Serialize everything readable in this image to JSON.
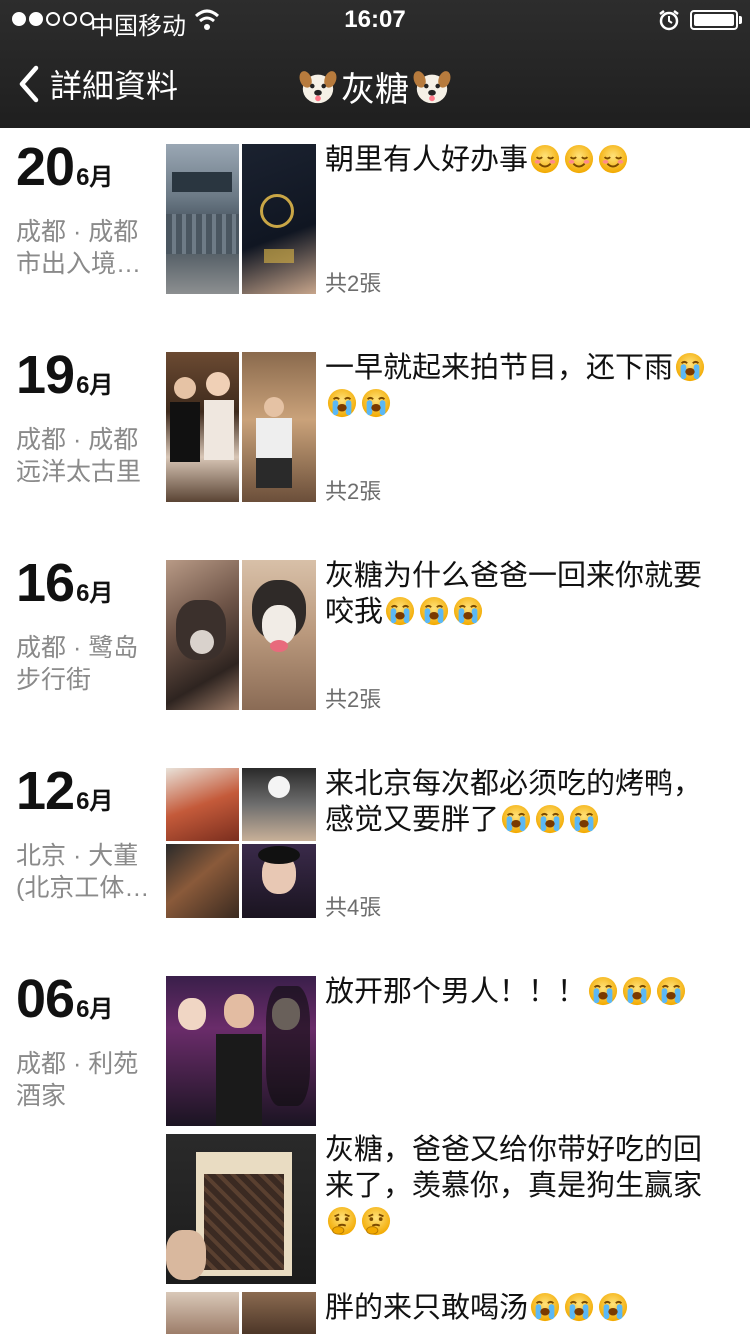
{
  "status": {
    "carrier": "中国移动",
    "time": "16:07"
  },
  "nav": {
    "back_label": "詳細資料",
    "title": "灰糖"
  },
  "entries": [
    {
      "day": "20",
      "month": "6月",
      "location_line1": "成都 · 成都",
      "location_line2": "市出入境…",
      "text": "朝里有人好办事",
      "emoji": [
        "blush-face",
        "blush-face",
        "blush-face"
      ],
      "count": "共2張"
    },
    {
      "day": "19",
      "month": "6月",
      "location_line1": "成都 · 成都",
      "location_line2": "远洋太古里",
      "text": "一早就起来拍节目，还下雨",
      "emoji": [
        "crying-face",
        "crying-face",
        "crying-face"
      ],
      "count": "共2張"
    },
    {
      "day": "16",
      "month": "6月",
      "location_line1": "成都 · 鹭岛",
      "location_line2": "步行街",
      "text": "灰糖为什么爸爸一回来你就要咬我",
      "emoji": [
        "crying-face",
        "crying-face",
        "crying-face"
      ],
      "count": "共2張"
    },
    {
      "day": "12",
      "month": "6月",
      "location_line1": "北京 · 大董",
      "location_line2": "(北京工体…",
      "text": "来北京每次都必须吃的烤鸭，感觉又要胖了",
      "emoji": [
        "crying-face",
        "crying-face",
        "crying-face"
      ],
      "count": "共4張"
    },
    {
      "day": "06",
      "month": "6月",
      "location_line1": "成都 · 利苑",
      "location_line2": "酒家",
      "posts": [
        {
          "text": "放开那个男人！！！",
          "emoji": [
            "crying-face",
            "crying-face",
            "crying-face"
          ]
        },
        {
          "text": "灰糖，爸爸又给你带好吃的回来了，羡慕你，真是狗生赢家",
          "emoji": [
            "thinking-face",
            "thinking-face"
          ]
        },
        {
          "text": "胖的来只敢喝汤",
          "emoji": [
            "crying-face",
            "crying-face",
            "crying-face"
          ]
        }
      ]
    }
  ]
}
